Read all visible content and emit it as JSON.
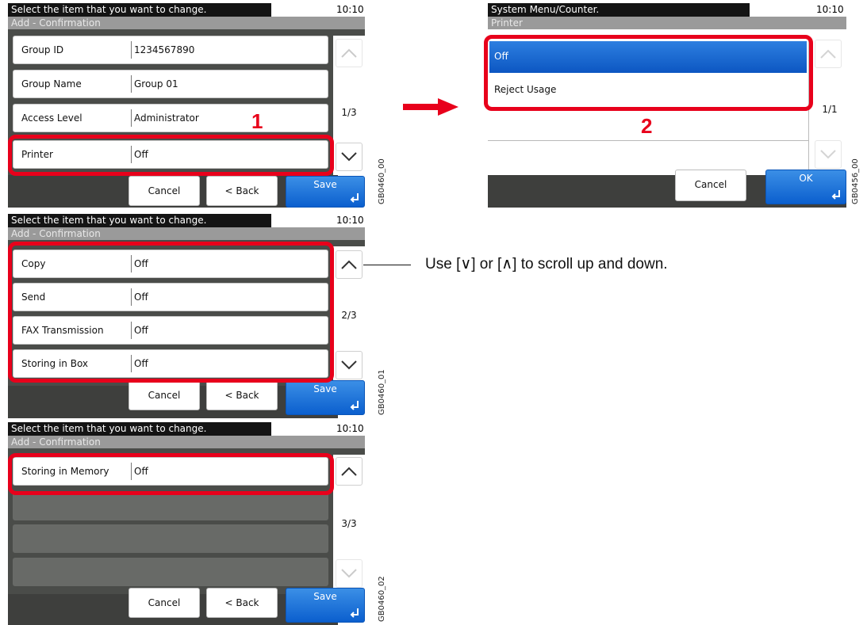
{
  "screen1": {
    "top_message": "Select the item that you want to change.",
    "time": "10:10",
    "subtitle": "Add - Confirmation",
    "rows": [
      {
        "label": "Group ID",
        "value": "1234567890"
      },
      {
        "label": "Group Name",
        "value": "Group 01"
      },
      {
        "label": "Access Level",
        "value": "Administrator"
      },
      {
        "label": "Printer",
        "value": "Off"
      }
    ],
    "page": "1/3",
    "cancel": "Cancel",
    "back": "< Back",
    "save": "Save",
    "code": "GB0460_00",
    "callout": "1"
  },
  "screen2": {
    "top_message": "Select the item that you want to change.",
    "time": "10:10",
    "subtitle": "Add - Confirmation",
    "rows": [
      {
        "label": "Copy",
        "value": "Off"
      },
      {
        "label": "Send",
        "value": "Off"
      },
      {
        "label": "FAX Transmission",
        "value": "Off"
      },
      {
        "label": "Storing in Box",
        "value": "Off"
      }
    ],
    "page": "2/3",
    "cancel": "Cancel",
    "back": "< Back",
    "save": "Save",
    "code": "GB0460_01"
  },
  "screen3": {
    "top_message": "Select the item that you want to change.",
    "time": "10:10",
    "subtitle": "Add - Confirmation",
    "rows": [
      {
        "label": "Storing in Memory",
        "value": "Off"
      }
    ],
    "page": "3/3",
    "cancel": "Cancel",
    "back": "< Back",
    "save": "Save",
    "code": "GB0460_02"
  },
  "screen4": {
    "top_message": "System Menu/Counter.",
    "time": "10:10",
    "subtitle": "Printer",
    "options": [
      {
        "label": "Off",
        "selected": true
      },
      {
        "label": "Reject Usage",
        "selected": false
      }
    ],
    "page": "1/1",
    "cancel": "Cancel",
    "ok": "OK",
    "code": "GB0456_00",
    "callout": "2"
  },
  "note": {
    "text": "Use [∨] or [∧] to scroll up and down."
  },
  "colors": {
    "accent_blue": "#0b5fce",
    "highlight_red": "#e8001b"
  }
}
